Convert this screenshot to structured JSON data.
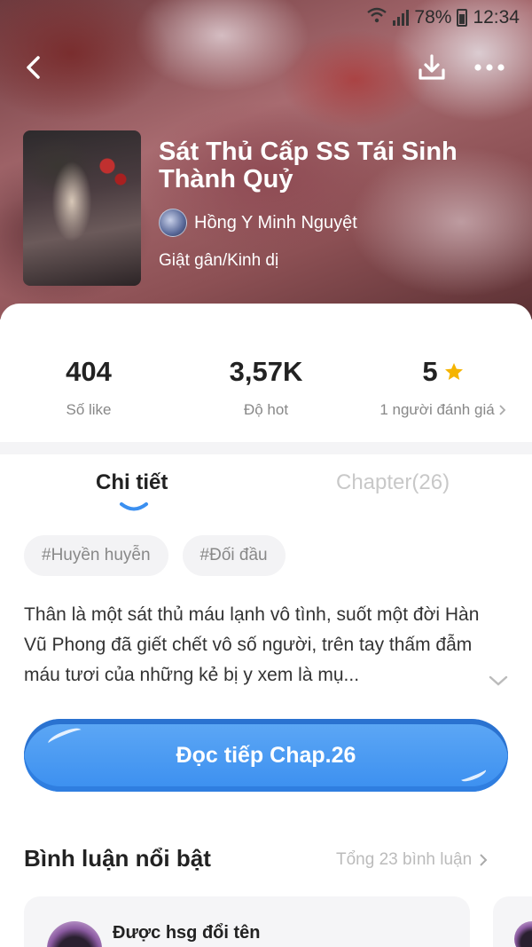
{
  "status_bar": {
    "battery": "78%",
    "time": "12:34"
  },
  "header": {
    "icons": {
      "back": "back-arrow-icon",
      "download": "download-icon",
      "more": "more-dots-icon"
    }
  },
  "comic": {
    "title": "Sát Thủ Cấp SS Tái Sinh Thành Quỷ",
    "author": "Hồng Y Minh Nguyệt",
    "genre": "Giật gân/Kinh dị"
  },
  "stats": {
    "likes": {
      "value": "404",
      "label": "Số like"
    },
    "hot": {
      "value": "3,57K",
      "label": "Độ hot"
    },
    "rating": {
      "value": "5",
      "label": "1 người đánh giá",
      "star_color": "#f5b400"
    }
  },
  "tabs": {
    "detail": "Chi tiết",
    "chapter": "Chapter(26)",
    "active": "detail",
    "accent": "#3b8ff0"
  },
  "tags": [
    "#Huyền huyễn",
    "#Đối đầu"
  ],
  "description": "Thân là một sát thủ máu lạnh vô tình, suốt một đời Hàn Vũ Phong đã giết chết vô số người, trên tay thấm đẫm máu tươi của những kẻ bị y xem là mụ...",
  "read_button": {
    "label": "Đọc tiếp Chap.26",
    "color": "#3b8ff0"
  },
  "comments": {
    "title": "Bình luận nổi bật",
    "total": "Tổng 23 bình luận",
    "first_user": "Được hsg đổi tên"
  }
}
